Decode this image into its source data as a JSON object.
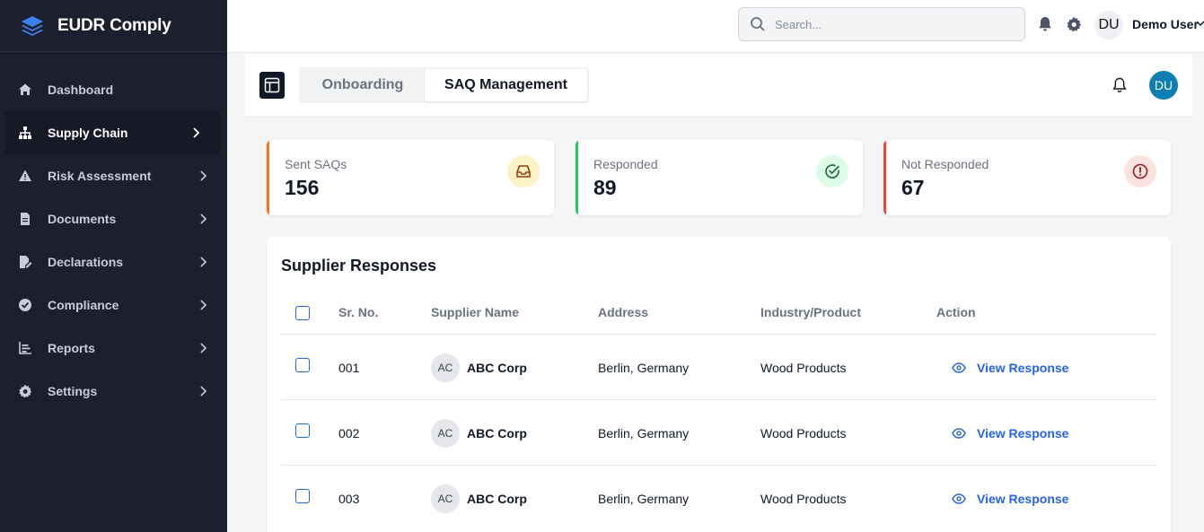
{
  "app": {
    "name": "EUDR Comply"
  },
  "sidebar": {
    "items": [
      {
        "label": "Dashboard",
        "icon": "home-icon"
      },
      {
        "label": "Supply Chain",
        "icon": "sitemap-icon",
        "active": true
      },
      {
        "label": "Risk Assessment",
        "icon": "warning-icon"
      },
      {
        "label": "Documents",
        "icon": "document-icon"
      },
      {
        "label": "Declarations",
        "icon": "file-signature-icon"
      },
      {
        "label": "Compliance",
        "icon": "check-circle-icon"
      },
      {
        "label": "Reports",
        "icon": "chart-bars-icon"
      },
      {
        "label": "Settings",
        "icon": "gear-icon"
      }
    ]
  },
  "header": {
    "search_placeholder": "Search...",
    "user_initials": "DU",
    "user_name": "Demo User"
  },
  "tabs": {
    "items": [
      {
        "label": "Onboarding"
      },
      {
        "label": "SAQ Management",
        "selected": true
      }
    ],
    "avatar_initials": "DU"
  },
  "stats": [
    {
      "label": "Sent SAQs",
      "value": "156",
      "accent": "#f97316",
      "icon": "inbox-icon",
      "icon_bg": "#fdf1c7",
      "icon_color": "#b45309"
    },
    {
      "label": "Responded",
      "value": "89",
      "accent": "#22c55e",
      "icon": "check-circle-icon",
      "icon_bg": "#dcfce7",
      "icon_color": "#15803d"
    },
    {
      "label": "Not Responded",
      "value": "67",
      "accent": "#ef4444",
      "icon": "alert-circle-icon",
      "icon_bg": "#fde2e2",
      "icon_color": "#b91c1c"
    }
  ],
  "table": {
    "title": "Supplier Responses",
    "columns": [
      "Sr. No.",
      "Supplier Name",
      "Address",
      "Industry/Product",
      "Action"
    ],
    "rows": [
      {
        "sr": "001",
        "initials": "AC",
        "name": "ABC Corp",
        "address": "Berlin, Germany",
        "industry": "Wood Products",
        "action": "View Response"
      },
      {
        "sr": "002",
        "initials": "AC",
        "name": "ABC Corp",
        "address": "Berlin, Germany",
        "industry": "Wood Products",
        "action": "View Response"
      },
      {
        "sr": "003",
        "initials": "AC",
        "name": "ABC Corp",
        "address": "Berlin, Germany",
        "industry": "Wood Products",
        "action": "View Response"
      }
    ]
  },
  "colors": {
    "sidebar_bg": "#1e1f2e",
    "link_blue": "#2563eb",
    "avatar_blue": "#0e7fb2"
  }
}
